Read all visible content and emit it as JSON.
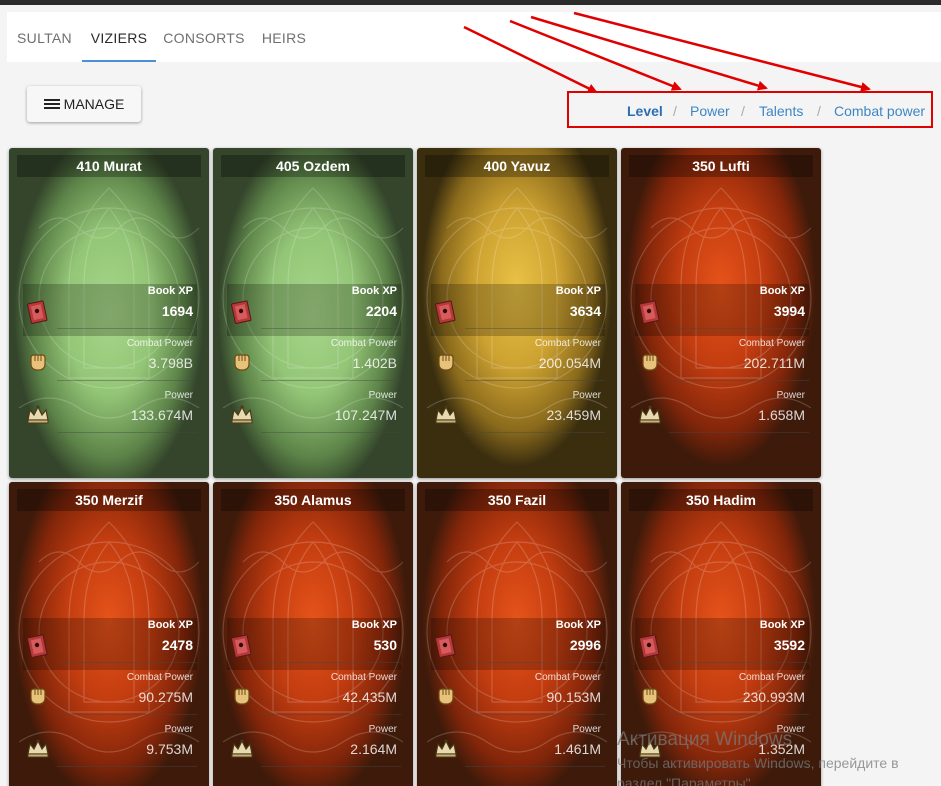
{
  "tabs": [
    {
      "label": "SULTAN"
    },
    {
      "label": "VIZIERS",
      "active": true
    },
    {
      "label": "CONSORTS"
    },
    {
      "label": "HEIRS"
    }
  ],
  "toolbar": {
    "manage_label": "MANAGE"
  },
  "sort_options": [
    {
      "label": "Level",
      "active": true
    },
    {
      "label": "Power"
    },
    {
      "label": "Talents"
    },
    {
      "label": "Combat power"
    }
  ],
  "sort_separator": "/",
  "stat_labels": {
    "book_xp": "Book XP",
    "combat_power": "Combat Power",
    "power": "Power"
  },
  "viziers": [
    {
      "title": "410 Murat",
      "book_xp": "1694",
      "combat_power": "3.798B",
      "power": "133.674M",
      "theme": "green"
    },
    {
      "title": "405 Ozdem",
      "book_xp": "2204",
      "combat_power": "1.402B",
      "power": "107.247M",
      "theme": "green"
    },
    {
      "title": "400 Yavuz",
      "book_xp": "3634",
      "combat_power": "200.054M",
      "power": "23.459M",
      "theme": "yellow"
    },
    {
      "title": "350 Lufti",
      "book_xp": "3994",
      "combat_power": "202.711M",
      "power": "1.658M",
      "theme": "red"
    },
    {
      "title": "350 Merzif",
      "book_xp": "2478",
      "combat_power": "90.275M",
      "power": "9.753M",
      "theme": "red"
    },
    {
      "title": "350 Alamus",
      "book_xp": "530",
      "combat_power": "42.435M",
      "power": "2.164M",
      "theme": "red"
    },
    {
      "title": "350 Fazil",
      "book_xp": "2996",
      "combat_power": "90.153M",
      "power": "1.461M",
      "theme": "red"
    },
    {
      "title": "350 Hadim",
      "book_xp": "3592",
      "combat_power": "230.993M",
      "power": "1.352M",
      "theme": "red"
    }
  ],
  "windows_watermark": {
    "title": "Активация Windows",
    "subtitle": "Чтобы активировать Windows, перейдите в раздел \"Параметры\"."
  },
  "colors": {
    "accent": "#4a90d9",
    "link": "#3d86c6",
    "annotation": "#e00000"
  },
  "icons": {
    "book": "book-icon",
    "fist": "fist-icon",
    "crown": "crown-icon",
    "menu": "menu-icon"
  }
}
